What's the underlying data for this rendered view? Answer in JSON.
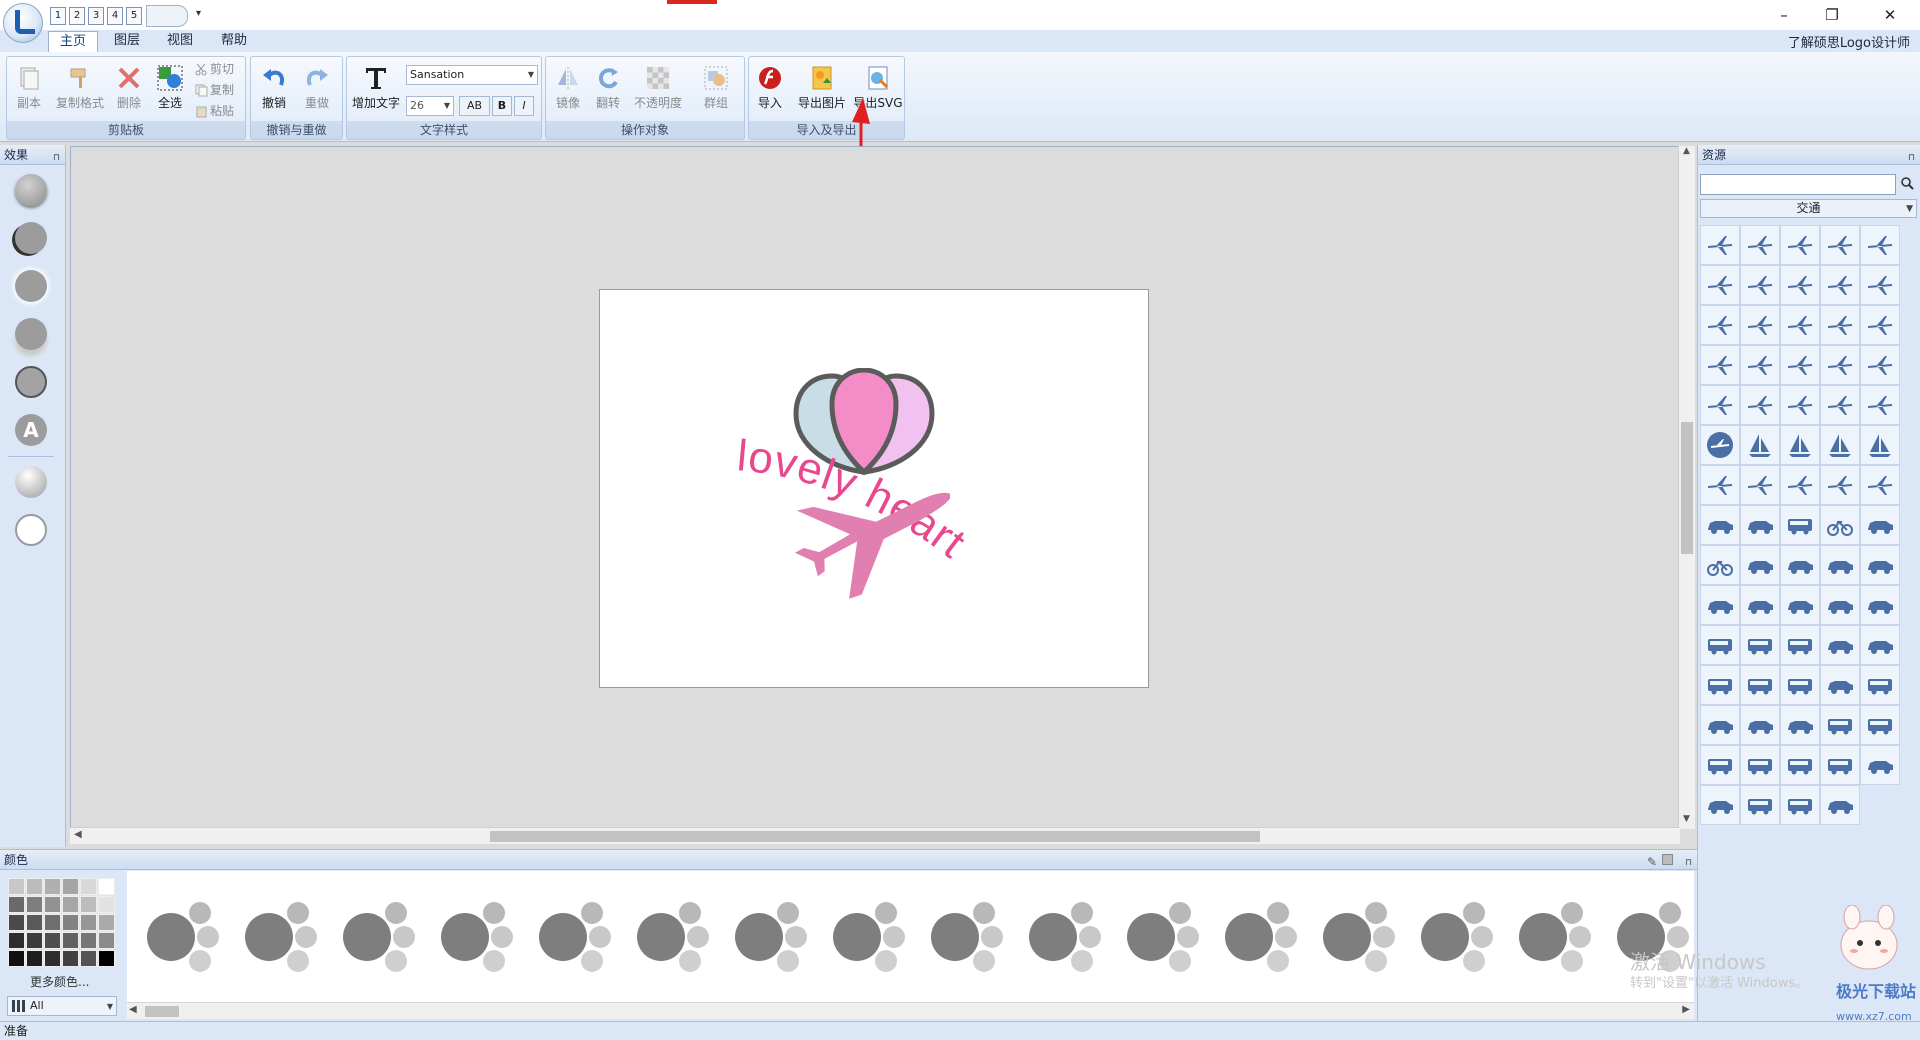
{
  "quick_access": {
    "buttons": [
      "1",
      "2",
      "3",
      "4",
      "5"
    ],
    "more": "▾"
  },
  "window": {
    "minimize": "–",
    "restore": "❐",
    "close": "✕"
  },
  "menu": {
    "tabs": [
      "主页",
      "图层",
      "视图",
      "帮助"
    ],
    "about": "了解硕思Logo设计师"
  },
  "ribbon": {
    "clipboard": {
      "label": "剪贴板",
      "copy_page": "副本",
      "copy_format": "复制格式",
      "delete": "删除",
      "select_all": "全选",
      "cut": "剪切",
      "copy": "复制",
      "paste": "粘贴"
    },
    "undo_group": {
      "label": "撤销与重做",
      "undo": "撤销",
      "redo": "重做"
    },
    "text_style": {
      "label": "文字样式",
      "add_text": "增加文字",
      "font": "Sansation",
      "size": "26",
      "spacing": "AB",
      "bold": "B",
      "italic": "I"
    },
    "operate": {
      "label": "操作对象",
      "mirror": "镜像",
      "flip": "翻转",
      "opacity": "不透明度",
      "group": "群组"
    },
    "import_export": {
      "label": "导入及导出",
      "import": "导入",
      "export_image": "导出图片",
      "export_svg": "导出SVG"
    }
  },
  "left_panel": {
    "title": "效果",
    "effects": [
      "raised-circle-effect",
      "shadow-circle-effect",
      "glow-circle-effect",
      "drop-shadow-effect",
      "outline-circle-effect",
      "text-effect",
      "gradient-circle-effect",
      "ring-effect"
    ],
    "text_effect_glyph": "A"
  },
  "canvas": {
    "logo_text": "lovely heart",
    "colors": {
      "text": "#e8498e",
      "plane": "#e07fb0",
      "heart_left": "#c9dde6",
      "heart_mid": "#f48cc8",
      "heart_right": "#f1c1f0",
      "heart_stroke": "#5b5b5b"
    }
  },
  "right_panel": {
    "title": "资源",
    "search_placeholder": "",
    "category": "交通",
    "icons": [
      "airliner-icon",
      "jet-icon",
      "fighter-jet-icon",
      "airplane-icon",
      "airplane-top-icon",
      "airplane-icon",
      "airplane-icon",
      "airplane-icon",
      "fighter-jet-icon",
      "helicopter-icon",
      "jet-icon",
      "fighter-jet-icon",
      "fighter-jet-icon",
      "glider-icon",
      "jet-icon",
      "jet-icon",
      "airplane-circle-icon",
      "jet-icon",
      "airliner-icon",
      "fighter-jet-icon",
      "jet-icon",
      "airplane-icon",
      "airplane-icon",
      "jet-icon",
      "jet-icon",
      "plane-badge-icon",
      "ship-icon",
      "sailboat-icon",
      "sailboat-icon",
      "ship-icon",
      "airplane-icon",
      "airplane-icon",
      "airplane-icon",
      "airplane-icon",
      "airplane-icon",
      "car-front-icon",
      "car-icon",
      "truck-icon",
      "motorcycle-icon",
      "horse-cart-icon",
      "bicycle-icon",
      "car-icon",
      "car-icon",
      "car-icon",
      "car-icon",
      "car-icon",
      "car-icon",
      "car-icon",
      "car-icon",
      "car-icon",
      "train-icon",
      "bus-icon",
      "bus-icon",
      "car-icon",
      "road-icon",
      "truck-icon",
      "bus-icon",
      "bus-icon",
      "car-icon",
      "truck-icon",
      "car-front-icon",
      "car-icon",
      "person-icon",
      "truck-icon",
      "truck-icon",
      "tractor-icon",
      "bus-icon",
      "bus-icon",
      "bus-front-icon",
      "car-icon",
      "car-icon",
      "truck-icon",
      "bus-icon",
      "car-icon"
    ]
  },
  "color_panel": {
    "title": "颜色",
    "more_colors": "更多颜色...",
    "filter": "All",
    "swatches": [
      "#c8c8c8",
      "#bcbcbc",
      "#b0b0b0",
      "#a4a4a4",
      "#d8d8d8",
      "#ffffff",
      "#6a6a6a",
      "#7e7e7e",
      "#929292",
      "#a6a6a6",
      "#bdbdbd",
      "#e2e2e2",
      "#4a4a4a",
      "#5a5a5a",
      "#6e6e6e",
      "#828282",
      "#969696",
      "#aaaaaa",
      "#2d2d2d",
      "#3c3c3c",
      "#4e4e4e",
      "#626262",
      "#767676",
      "#8a8a8a",
      "#111111",
      "#1e1e1e",
      "#2e2e2e",
      "#404040",
      "#545454",
      "#000000"
    ],
    "palette_count": 16
  },
  "status": "准备",
  "watermark": {
    "activate": "激活 Windows",
    "activate_sub": "转到\"设置\"以激活 Windows。",
    "site": "极光下载站",
    "site_url": "www.xz7.com"
  }
}
